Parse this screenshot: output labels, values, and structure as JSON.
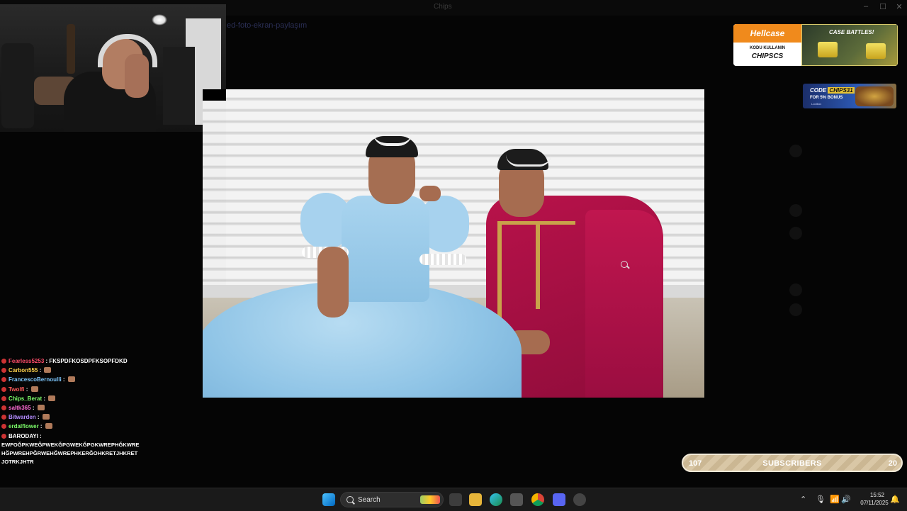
{
  "window": {
    "app_title": "Chips",
    "controls": [
      "–",
      "☐",
      "✕"
    ]
  },
  "channel": {
    "name": "ed-foto-ekran-paylaşım"
  },
  "chat": [
    {
      "user": "Fearless5253",
      "user_color": "#ff4d6a",
      "message": " : FKSPDFKOSDPFKSOPFDKD",
      "emote": false
    },
    {
      "user": "Carbon555",
      "user_color": "#ffd24d",
      "message": " : ",
      "emote": true
    },
    {
      "user": "FrancescoBernoulli",
      "user_color": "#7ec8ff",
      "message": " : ",
      "emote": true
    },
    {
      "user": "Twolfi",
      "user_color": "#ff5c5c",
      "message": " : ",
      "emote": true
    },
    {
      "user": "Chips_Berat",
      "user_color": "#7dff6a",
      "message": " : ",
      "emote": true
    },
    {
      "user": "saltk365",
      "user_color": "#ff6bd6",
      "message": " : ",
      "emote": true
    },
    {
      "user": "Bitwarden",
      "user_color": "#b48cff",
      "message": " : ",
      "emote": true
    },
    {
      "user": "erdalflower",
      "user_color": "#7dff6a",
      "message": " : ",
      "emote": true
    },
    {
      "user": "BARODAYI",
      "user_color": "#ffffff",
      "message": " :",
      "emote": false
    }
  ],
  "chat_wrapped_message": "EWFOĞPKWEĞPWEKĞPGWEKĞPGKWREPHĞKWREHĞPWREHPĞRWEHĞWREPHKERĞOHKRETJHKRETJOTRKJHTR",
  "ads": {
    "hellcase_logo": "Hellcase",
    "hellcase_sub": "KODU KULLANIN",
    "hellcase_code": "CHIPSCS",
    "hellcase_title": "CASE BATTLES!",
    "lootbox_code_prefix": "CODE",
    "lootbox_code": "CHIPS31",
    "lootbox_bonus": "FOR 5% BONUS",
    "lootbox_brand": "Lootbox"
  },
  "subscribers": {
    "left_value": "107",
    "label": "SUBSCRIBERS",
    "right_value": "20"
  },
  "taskbar": {
    "search_placeholder": "Search",
    "time": "15:52",
    "date": "07/11/2025"
  }
}
